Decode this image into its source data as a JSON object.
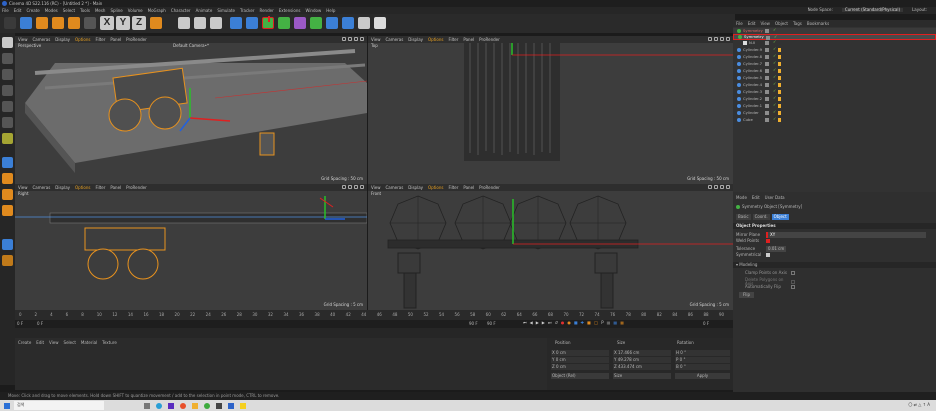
{
  "window": {
    "title": "Cinema 4D S22.116 (RC) - [Untitled 2 *] - Main"
  },
  "menu": {
    "items": [
      "File",
      "Edit",
      "Create",
      "Modes",
      "Select",
      "Tools",
      "Mesh",
      "Spline",
      "Volume",
      "MoGraph",
      "Character",
      "Animate",
      "Simulate",
      "Tracker",
      "Render",
      "Extensions",
      "Window",
      "Help"
    ],
    "node_space_label": "Node Space:",
    "node_space_value": "Current (Standard/Physical)",
    "layout_label": "Layout:"
  },
  "toolbar": {
    "axis_letters": [
      "X",
      "Y",
      "Z"
    ]
  },
  "viewport_menu": [
    "View",
    "Cameras",
    "Display",
    "Options",
    "Filter",
    "Panel",
    "ProRender"
  ],
  "viewports": {
    "perspective": {
      "label": "Perspective",
      "camera": "Default Camera•*",
      "grid": "Grid Spacing : 50 cm"
    },
    "top": {
      "label": "Top",
      "grid": "Grid Spacing : 50 cm"
    },
    "right": {
      "label": "Right",
      "grid": "Grid Spacing : 5 cm"
    },
    "front": {
      "label": "Front",
      "grid": "Grid Spacing : 5 cm"
    }
  },
  "objects": {
    "menu": [
      "File",
      "Edit",
      "View",
      "Object",
      "Tags",
      "Bookmarks"
    ],
    "items": [
      {
        "name": "Symmetry"
      },
      {
        "name": "Symmetry"
      },
      {
        "name": "N.II"
      },
      {
        "name": "Cylinder.9"
      },
      {
        "name": "Cylinder.8"
      },
      {
        "name": "Cylinder.7"
      },
      {
        "name": "Cylinder.6"
      },
      {
        "name": "Cylinder.5"
      },
      {
        "name": "Cylinder.4"
      },
      {
        "name": "Cylinder.3"
      },
      {
        "name": "Cylinder.2"
      },
      {
        "name": "Cylinder.1"
      },
      {
        "name": "Cylinder"
      },
      {
        "name": "Cube"
      }
    ]
  },
  "attributes": {
    "menu": [
      "Mode",
      "Edit",
      "User Data"
    ],
    "object_title": "Symmetry Object [Symmetry]",
    "tabs": [
      "Basic",
      "Coord.",
      "Object"
    ],
    "section": "Object Properties",
    "mirror_plane_label": "Mirror Plane",
    "mirror_plane_value": "XY",
    "weld_points_label": "Weld Points",
    "tolerance_label": "Tolerance",
    "tolerance_value": "0.01 cm",
    "symmetrical_label": "Symmetrical",
    "modeling_section": "▾ Modeling",
    "clamp_label": "Clamp Points on Axis",
    "delete_label": "Delete Polygons on Axis",
    "autoflip_label": "Automatically Flip",
    "flip_button": "Flip"
  },
  "timeline": {
    "ticks": [
      "0",
      "2",
      "4",
      "6",
      "8",
      "10",
      "12",
      "14",
      "16",
      "18",
      "20",
      "22",
      "24",
      "26",
      "28",
      "30",
      "32",
      "34",
      "36",
      "38",
      "40",
      "42",
      "44",
      "46",
      "48",
      "50",
      "52",
      "54",
      "56",
      "58",
      "60",
      "62",
      "64",
      "66",
      "68",
      "70",
      "72",
      "74",
      "76",
      "78",
      "80",
      "82",
      "84",
      "86",
      "88",
      "90"
    ],
    "start_frame": "0 F",
    "current_frame": "0 F",
    "end_frame": "90 F",
    "end_frame2": "90 F",
    "right_frame": "0 F"
  },
  "materials": {
    "menu": [
      "Create",
      "Edit",
      "View",
      "Select",
      "Material",
      "Texture"
    ]
  },
  "coordinates": {
    "col_position": "Position",
    "col_size": "Size",
    "col_rotation": "Rotation",
    "rows": [
      {
        "pos": "X  0 cm",
        "size": "X  17.466 cm",
        "rot": "H  0 °"
      },
      {
        "pos": "Y  0 cm",
        "size": "Y  49.278 cm",
        "rot": "P  0 °"
      },
      {
        "pos": "Z  0 cm",
        "size": "Z  433.474 cm",
        "rot": "B  0 °"
      }
    ],
    "mode1": "Object (Rel)",
    "mode2": "Size",
    "apply": "Apply"
  },
  "status": {
    "text": "Move: Click and drag to move elements. Hold down SHIFT to quantize movement / add to the selection in point mode, CTRL to remove."
  },
  "taskbar": {
    "search": "검색",
    "clock": "〇 ⇄ △ ↑ A"
  }
}
